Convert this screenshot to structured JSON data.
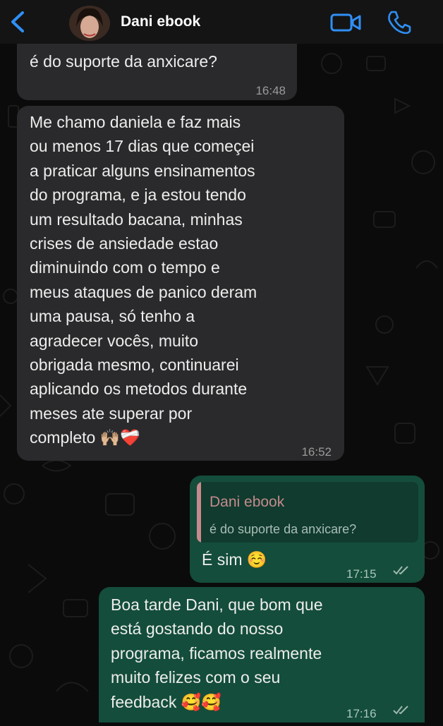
{
  "header": {
    "contact_name": "Dani ebook"
  },
  "messages": [
    {
      "direction": "incoming",
      "text": "é do suporte da anxicare?",
      "time": "16:48"
    },
    {
      "direction": "incoming",
      "text": "Me chamo daniela e faz mais\nou menos 17 dias que começei\na praticar alguns ensinamentos\ndo programa, e ja estou tendo\num resultado bacana, minhas\ncrises de ansiedade estao\ndiminuindo com o tempo e\nmeus ataques de panico deram\numa pausa, só tenho a\nagradecer vocês, muito\nobrigada mesmo, continuarei\naplicando os metodos durante\nmeses ate superar por\ncompleto 🙌🏼❤️‍🩹",
      "time": "16:52"
    },
    {
      "direction": "outgoing",
      "quote_author": "Dani ebook",
      "quote_text": "é do suporte da anxicare?",
      "text": "É sim ☺️",
      "time": "17:15",
      "status": "read"
    },
    {
      "direction": "outgoing",
      "text": "Boa tarde Dani, que bom que\nestá gostando do nosso\nprograma, ficamos realmente\nmuito felizes com o seu\nfeedback 🥰🥰",
      "time": "17:16",
      "status": "read"
    }
  ],
  "colors": {
    "accent": "#2f8ff5",
    "incoming_bubble": "#2a2a2c",
    "outgoing_bubble": "#144d3b",
    "quote_author": "#c48a8c"
  }
}
